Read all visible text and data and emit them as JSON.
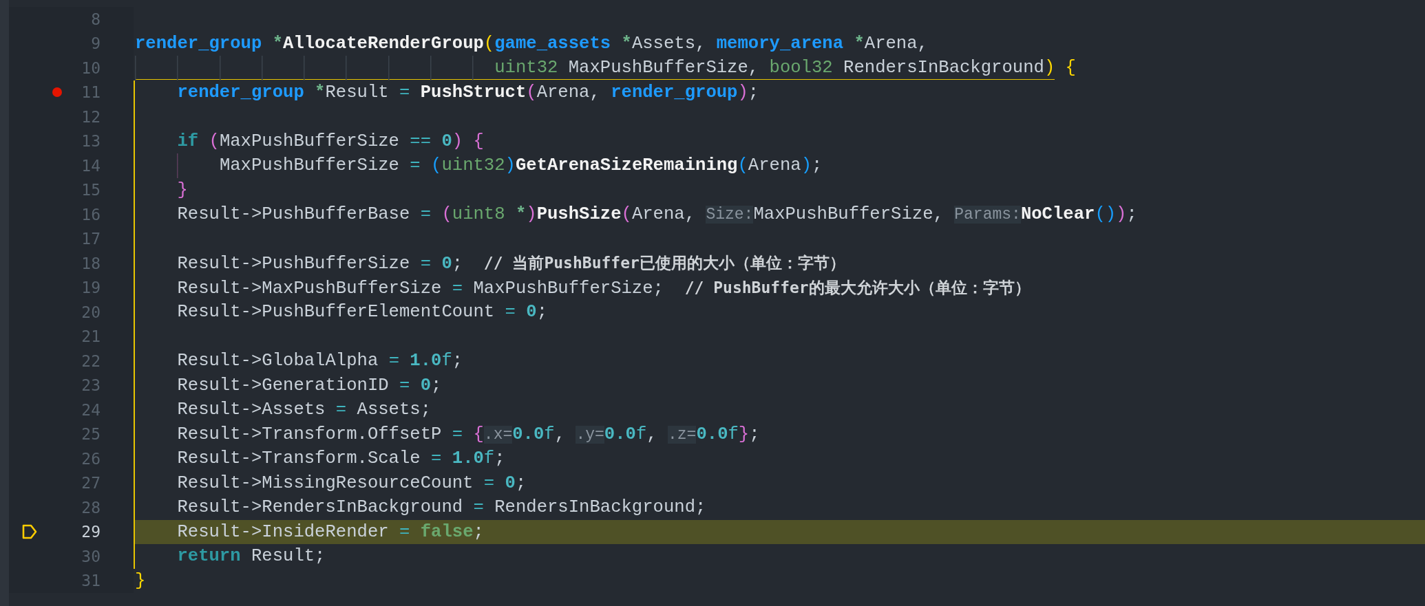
{
  "lines": [
    {
      "number": "8"
    },
    {
      "number": "9",
      "tokens": [
        {
          "kind": "type",
          "text": "render_group "
        },
        {
          "kind": "ptr",
          "text": "*"
        },
        {
          "kind": "func",
          "text": "AllocateRenderGroup"
        },
        {
          "kind": "bracket",
          "text": "(",
          "color": "#ffd700"
        },
        {
          "kind": "type",
          "text": "game_assets "
        },
        {
          "kind": "ptr",
          "text": "*"
        },
        {
          "kind": "plain",
          "text": "Assets, "
        },
        {
          "kind": "type",
          "text": "memory_arena "
        },
        {
          "kind": "ptr",
          "text": "*"
        },
        {
          "kind": "plain",
          "text": "Arena,"
        }
      ]
    },
    {
      "number": "10",
      "scope_start": true,
      "tokens": [
        {
          "kind": "builtin",
          "text": "                                  uint32"
        },
        {
          "kind": "plain",
          "text": " MaxPushBufferSize, "
        },
        {
          "kind": "builtin",
          "text": "bool32"
        },
        {
          "kind": "plain",
          "text": " RendersInBackground"
        },
        {
          "kind": "bracket",
          "text": ")",
          "color": "#ffd700"
        },
        {
          "kind": "bracket",
          "text": " {",
          "color": "#ffd700"
        }
      ]
    },
    {
      "number": "11",
      "in_scope": true,
      "breakpoint": true,
      "tokens": [
        {
          "kind": "type",
          "text": "    render_group "
        },
        {
          "kind": "ptr",
          "text": "*"
        },
        {
          "kind": "plain",
          "text": "Result "
        },
        {
          "kind": "op",
          "text": "= "
        },
        {
          "kind": "func",
          "text": "PushStruct"
        },
        {
          "kind": "bracket",
          "text": "(",
          "color": "#da70d6"
        },
        {
          "kind": "plain",
          "text": "Arena, "
        },
        {
          "kind": "type",
          "text": "render_group"
        },
        {
          "kind": "bracket",
          "text": ")",
          "color": "#da70d6"
        },
        {
          "kind": "plain",
          "text": ";"
        }
      ]
    },
    {
      "number": "12",
      "in_scope": true
    },
    {
      "number": "13",
      "in_scope": true,
      "tokens": [
        {
          "kind": "keyword",
          "text": "    if "
        },
        {
          "kind": "bracket",
          "text": "(",
          "color": "#da70d6"
        },
        {
          "kind": "plain",
          "text": "MaxPushBufferSize "
        },
        {
          "kind": "op",
          "text": "== "
        },
        {
          "kind": "number",
          "text": "0"
        },
        {
          "kind": "bracket",
          "text": ")",
          "color": "#da70d6"
        },
        {
          "kind": "bracket",
          "text": " {",
          "color": "#da70d6"
        }
      ]
    },
    {
      "number": "14",
      "in_scope": true,
      "tokens": [
        {
          "kind": "plain",
          "text": "        MaxPushBufferSize "
        },
        {
          "kind": "op",
          "text": "= "
        },
        {
          "kind": "bracket",
          "text": "(",
          "color": "#179fff"
        },
        {
          "kind": "builtin",
          "text": "uint32"
        },
        {
          "kind": "bracket",
          "text": ")",
          "color": "#179fff"
        },
        {
          "kind": "func",
          "text": "GetArenaSizeRemaining"
        },
        {
          "kind": "bracket",
          "text": "(",
          "color": "#179fff"
        },
        {
          "kind": "plain",
          "text": "Arena"
        },
        {
          "kind": "bracket",
          "text": ")",
          "color": "#179fff"
        },
        {
          "kind": "plain",
          "text": ";"
        }
      ]
    },
    {
      "number": "15",
      "in_scope": true,
      "tokens": [
        {
          "kind": "bracket",
          "text": "    }",
          "color": "#da70d6"
        }
      ]
    },
    {
      "number": "16",
      "in_scope": true,
      "tokens": [
        {
          "kind": "plain",
          "text": "    Result->PushBufferBase "
        },
        {
          "kind": "op",
          "text": "= "
        },
        {
          "kind": "bracket",
          "text": "(",
          "color": "#da70d6"
        },
        {
          "kind": "builtin",
          "text": "uint8 "
        },
        {
          "kind": "ptr",
          "text": "*"
        },
        {
          "kind": "bracket",
          "text": ")",
          "color": "#da70d6"
        },
        {
          "kind": "func",
          "text": "PushSize"
        },
        {
          "kind": "bracket",
          "text": "(",
          "color": "#da70d6"
        },
        {
          "kind": "plain",
          "text": "Arena, "
        },
        {
          "kind": "hint",
          "text": "Size:"
        },
        {
          "kind": "plain",
          "text": "MaxPushBufferSize, "
        },
        {
          "kind": "hint",
          "text": "Params:"
        },
        {
          "kind": "func",
          "text": "NoClear"
        },
        {
          "kind": "bracket",
          "text": "()",
          "color": "#179fff"
        },
        {
          "kind": "bracket",
          "text": ")",
          "color": "#da70d6"
        },
        {
          "kind": "plain",
          "text": ";"
        }
      ]
    },
    {
      "number": "17",
      "in_scope": true
    },
    {
      "number": "18",
      "in_scope": true,
      "tokens": [
        {
          "kind": "plain",
          "text": "    Result->PushBufferSize "
        },
        {
          "kind": "op",
          "text": "= "
        },
        {
          "kind": "number",
          "text": "0"
        },
        {
          "kind": "plain",
          "text": ";  "
        },
        {
          "kind": "comment",
          "text": "// 当前PushBuffer已使用的大小（单位：字节）"
        }
      ]
    },
    {
      "number": "19",
      "in_scope": true,
      "tokens": [
        {
          "kind": "plain",
          "text": "    Result->MaxPushBufferSize "
        },
        {
          "kind": "op",
          "text": "="
        },
        {
          "kind": "plain",
          "text": " MaxPushBufferSize;  "
        },
        {
          "kind": "comment",
          "text": "// PushBuffer的最大允许大小（单位：字节）"
        }
      ]
    },
    {
      "number": "20",
      "in_scope": true,
      "tokens": [
        {
          "kind": "plain",
          "text": "    Result->PushBufferElementCount "
        },
        {
          "kind": "op",
          "text": "= "
        },
        {
          "kind": "number",
          "text": "0"
        },
        {
          "kind": "plain",
          "text": ";"
        }
      ]
    },
    {
      "number": "21",
      "in_scope": true
    },
    {
      "number": "22",
      "in_scope": true,
      "tokens": [
        {
          "kind": "plain",
          "text": "    Result->GlobalAlpha "
        },
        {
          "kind": "op",
          "text": "= "
        },
        {
          "kind": "number",
          "text": "1.0"
        },
        {
          "kind": "suffix",
          "text": "f"
        },
        {
          "kind": "plain",
          "text": ";"
        }
      ]
    },
    {
      "number": "23",
      "in_scope": true,
      "tokens": [
        {
          "kind": "plain",
          "text": "    Result->GenerationID "
        },
        {
          "kind": "op",
          "text": "= "
        },
        {
          "kind": "number",
          "text": "0"
        },
        {
          "kind": "plain",
          "text": ";"
        }
      ]
    },
    {
      "number": "24",
      "in_scope": true,
      "tokens": [
        {
          "kind": "plain",
          "text": "    Result->Assets "
        },
        {
          "kind": "op",
          "text": "="
        },
        {
          "kind": "plain",
          "text": " Assets;"
        }
      ]
    },
    {
      "number": "25",
      "in_scope": true,
      "tokens": [
        {
          "kind": "plain",
          "text": "    Result->Transform.OffsetP "
        },
        {
          "kind": "op",
          "text": "= "
        },
        {
          "kind": "bracket",
          "text": "{",
          "color": "#da70d6"
        },
        {
          "kind": "hint",
          "text": ".x="
        },
        {
          "kind": "number",
          "text": "0.0"
        },
        {
          "kind": "suffix",
          "text": "f"
        },
        {
          "kind": "plain",
          "text": ", "
        },
        {
          "kind": "hint",
          "text": ".y="
        },
        {
          "kind": "number",
          "text": "0.0"
        },
        {
          "kind": "suffix",
          "text": "f"
        },
        {
          "kind": "plain",
          "text": ", "
        },
        {
          "kind": "hint",
          "text": ".z="
        },
        {
          "kind": "number",
          "text": "0.0"
        },
        {
          "kind": "suffix",
          "text": "f"
        },
        {
          "kind": "bracket",
          "text": "}",
          "color": "#da70d6"
        },
        {
          "kind": "plain",
          "text": ";"
        }
      ]
    },
    {
      "number": "26",
      "in_scope": true,
      "tokens": [
        {
          "kind": "plain",
          "text": "    Result->Transform.Scale "
        },
        {
          "kind": "op",
          "text": "= "
        },
        {
          "kind": "number",
          "text": "1.0"
        },
        {
          "kind": "suffix",
          "text": "f"
        },
        {
          "kind": "plain",
          "text": ";"
        }
      ]
    },
    {
      "number": "27",
      "in_scope": true,
      "tokens": [
        {
          "kind": "plain",
          "text": "    Result->MissingResourceCount "
        },
        {
          "kind": "op",
          "text": "= "
        },
        {
          "kind": "number",
          "text": "0"
        },
        {
          "kind": "plain",
          "text": ";"
        }
      ]
    },
    {
      "number": "28",
      "in_scope": true,
      "tokens": [
        {
          "kind": "plain",
          "text": "    Result->RendersInBackground "
        },
        {
          "kind": "op",
          "text": "="
        },
        {
          "kind": "plain",
          "text": " RendersInBackground;"
        }
      ]
    },
    {
      "number": "29",
      "in_scope": true,
      "current": true,
      "tokens": [
        {
          "kind": "plain",
          "text": "    Result->InsideRender "
        },
        {
          "kind": "op",
          "text": "= "
        },
        {
          "kind": "literal",
          "text": "false"
        },
        {
          "kind": "plain",
          "text": ";"
        }
      ]
    },
    {
      "number": "30",
      "in_scope": true,
      "tokens": [
        {
          "kind": "keyword",
          "text": "    return"
        },
        {
          "kind": "plain",
          "text": " Result;"
        }
      ]
    },
    {
      "number": "31",
      "tokens": [
        {
          "kind": "bracket",
          "text": "}",
          "color": "#ffd700"
        }
      ]
    }
  ]
}
